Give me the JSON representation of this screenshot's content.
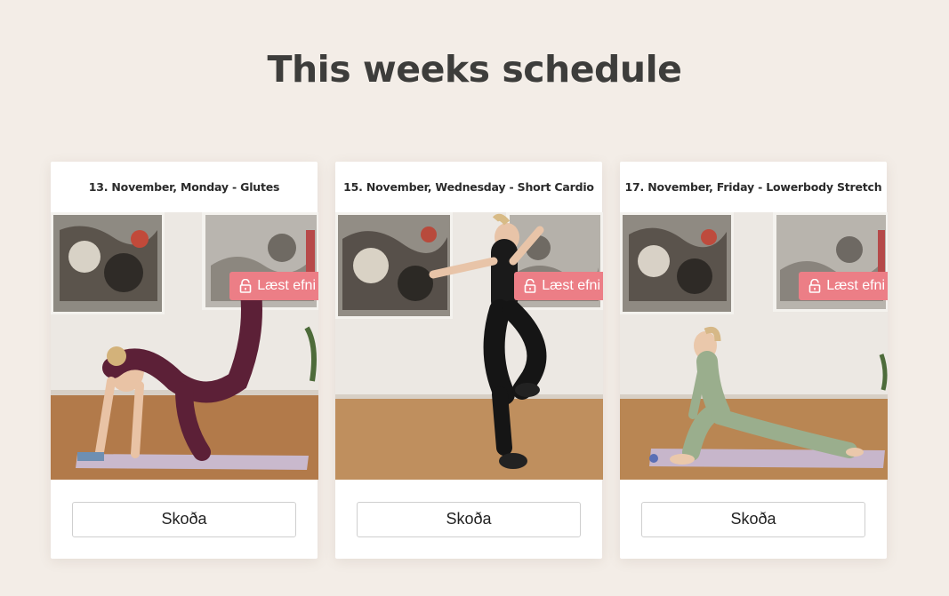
{
  "page": {
    "title": "This weeks schedule"
  },
  "schedule": [
    {
      "title": "13. November, Monday - Glutes",
      "badge": "Læst efni",
      "button": "Skoða"
    },
    {
      "title": "15. November, Wednesday - Short Cardio",
      "badge": "Læst efni",
      "button": "Skoða"
    },
    {
      "title": "17. November, Friday - Lowerbody Stretch",
      "badge": "Læst efni",
      "button": "Skoða"
    }
  ],
  "colors": {
    "background": "#f3ede7",
    "badge": "#ec7e86",
    "title": "#3d3d3b"
  },
  "icons": {
    "badge": "unlock-icon"
  }
}
